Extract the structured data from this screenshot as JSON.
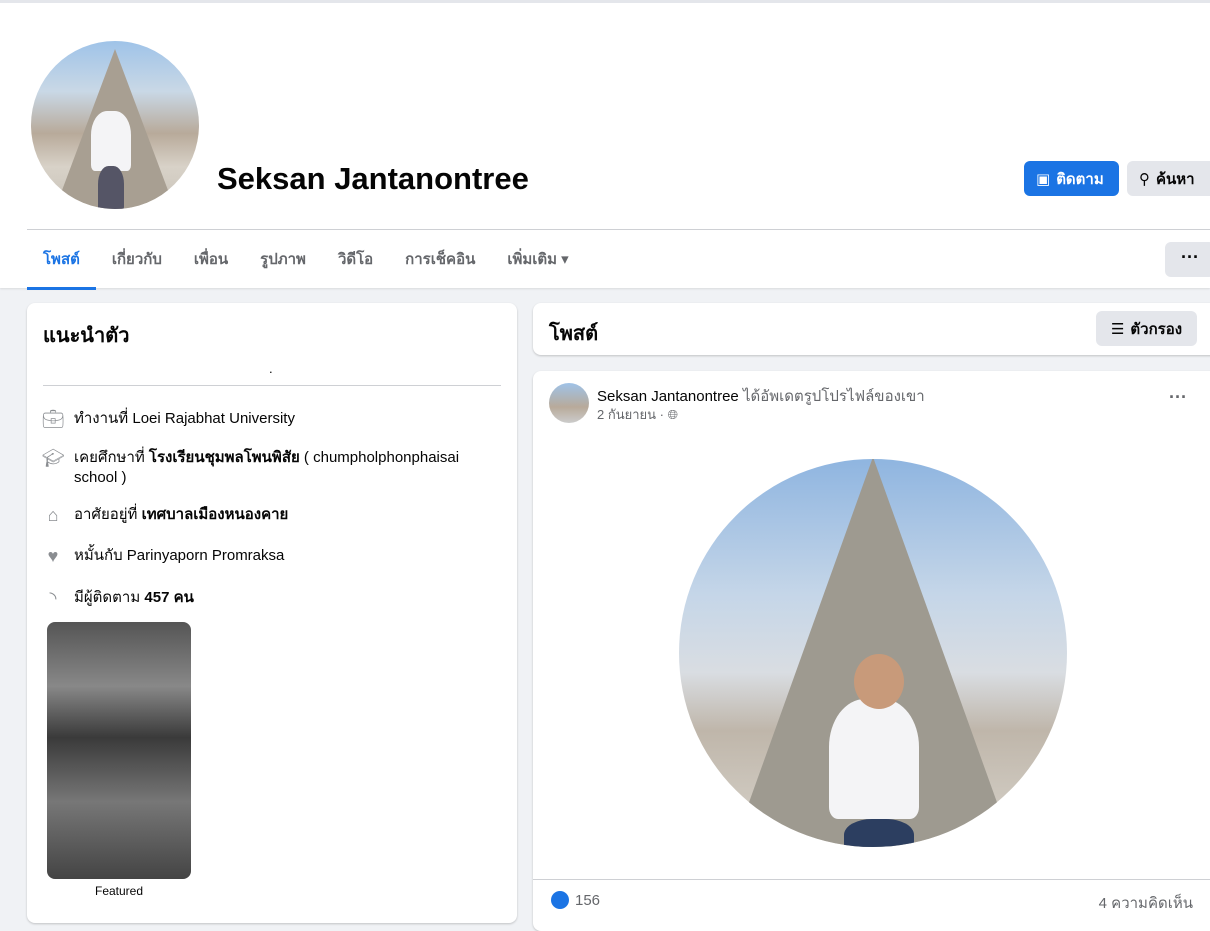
{
  "profile": {
    "name": "Seksan Jantanontree",
    "follow_label": "ติดตาม",
    "search_label": "ค้นหา",
    "more_label": "···"
  },
  "tabs": [
    {
      "label": "โพสต์"
    },
    {
      "label": "เกี่ยวกับ"
    },
    {
      "label": "เพื่อน"
    },
    {
      "label": "รูปภาพ"
    },
    {
      "label": "วิดีโอ"
    },
    {
      "label": "การเช็คอิน"
    },
    {
      "label": "เพิ่มเติม ▾"
    }
  ],
  "intro": {
    "title": "แนะนำตัว",
    "dot": ".",
    "work": "ทำงานที่ Loei Rajabhat University",
    "edu_prefix": "เคยศึกษาที่ ",
    "edu_school": "โรงเรียนชุมพลโพนพิสัย",
    "edu_suffix": " ( chumpholphonphaisai school )",
    "live_prefix": "อาศัยอยู่ที่ ",
    "live_place": "เทศบาลเมืองหนองคาย",
    "relationship": "หมั้นกับ Parinyaporn Promraksa",
    "followers_prefix": "มีผู้ติดตาม ",
    "followers_count": "457",
    "followers_suffix": " คน",
    "featured_label": "Featured"
  },
  "posts": {
    "title": "โพสต์",
    "filter_label": "ตัวกรอง"
  },
  "post": {
    "author": "Seksan Jantanontree",
    "action": " ได้อัพเดตรูปโปรไฟล์ของเขา",
    "date": "2 กันยายน · ",
    "likes": "156",
    "comments": "4 ความคิดเห็น",
    "accent": "#1b74e4"
  }
}
